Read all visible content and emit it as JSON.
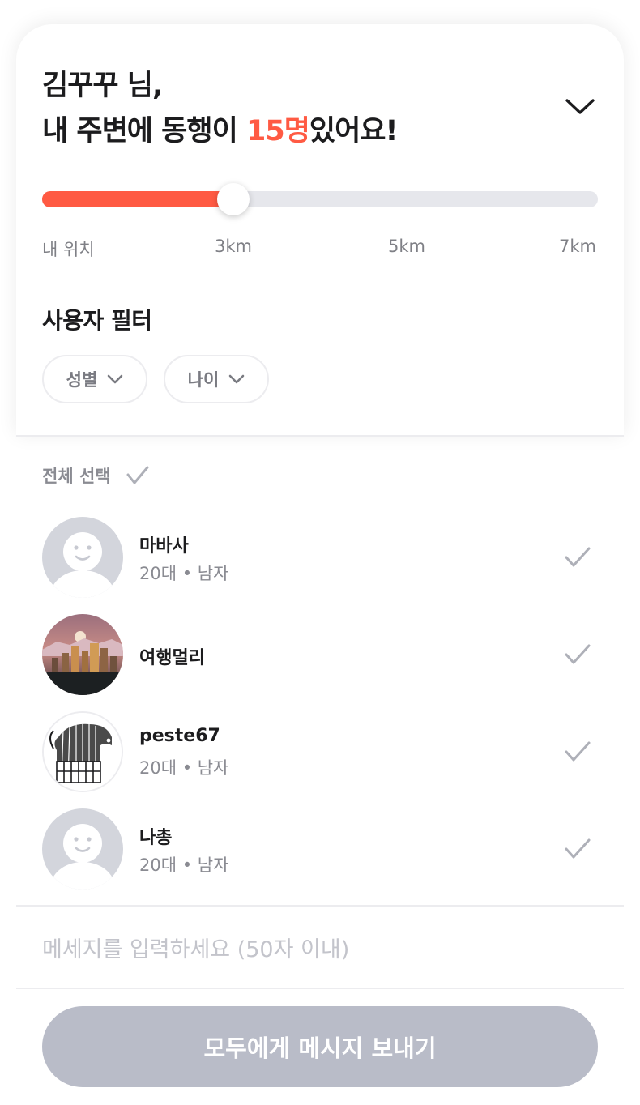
{
  "header": {
    "line1": "김꾸꾸 님,",
    "line2_pre": "내 주변에 동행이 ",
    "line2_count": "15명",
    "line2_post": "있어요!",
    "collapse_icon": "chevron-down-icon"
  },
  "distance": {
    "ticks": [
      "내 위치",
      "3km",
      "5km",
      "7km"
    ],
    "value_km": 3,
    "max_km": 7,
    "accent_color": "#ff5a43",
    "track_color": "#e6e7ec"
  },
  "filters": {
    "title": "사용자 필터",
    "chips": [
      {
        "label": "성별",
        "icon": "chevron-down-icon"
      },
      {
        "label": "나이",
        "icon": "chevron-down-icon"
      }
    ]
  },
  "list": {
    "select_all_label": "전체 선택",
    "users": [
      {
        "name": "마바사",
        "meta": "20대 • 남자",
        "avatar": "default-avatar"
      },
      {
        "name": "여행멀리",
        "meta": "",
        "avatar": "city-skyline-photo"
      },
      {
        "name": "peste67",
        "meta": "20대 • 남자",
        "avatar": "dog-drawing"
      },
      {
        "name": "나총",
        "meta": "20대 • 남자",
        "avatar": "default-avatar"
      }
    ]
  },
  "composer": {
    "placeholder": "메세지를 입력하세요 (50자 이내)",
    "send_label": "모두에게 메시지 보내기",
    "button_color": "#b9bcc8"
  }
}
